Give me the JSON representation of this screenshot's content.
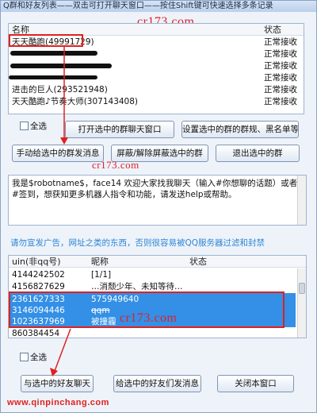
{
  "window": {
    "title": "Q群和好友列表——双击可打开聊天窗口——按住Shift键可快速选择多条记录"
  },
  "watermarks": {
    "top": "cr173.com",
    "mid": "cr173.com",
    "table": "cr173.com",
    "footer": "www.qinpinchang.com"
  },
  "groups": {
    "header_name": "名称",
    "header_status": "状态",
    "rows": [
      {
        "name": "天天酷跑(49991729)",
        "status": "正常接收"
      },
      {
        "name": "",
        "status": "正常接收"
      },
      {
        "name": "",
        "status": "正常接收"
      },
      {
        "name": "",
        "status": "正常接收"
      },
      {
        "name": "进击的巨人(293521948)",
        "status": "正常接收"
      },
      {
        "name": "天天酷跑♪节奏大师(307143408)",
        "status": "正常接收"
      }
    ],
    "select_all": "全选",
    "btn_open": "打开选中的群聊天窗口",
    "btn_rules": "设置选中的群的群规、黑名单等",
    "btn_send": "手动给选中的群发消息",
    "btn_block": "屏蔽/解除屏蔽选中的群",
    "btn_quit": "退出选中的群"
  },
  "message": {
    "text": "我是$robotname$，face14 欢迎大家找我聊天（输入#你想聊的话题）或者#签到，想获知更多机器人指令和功能，请发送help或帮助。"
  },
  "notice": "请勿宣发广告，网址之类的东西，否则很容易被QQ服务器过滤和封禁",
  "friends": {
    "header_uin": "uin(非qq号)",
    "header_nick": "昵称",
    "header_status": "状态",
    "rows": [
      {
        "uin": "4144242502",
        "nick": "[1/1]"
      },
      {
        "uin": "4156827629",
        "nick": "…消颓少年、未知等待…"
      },
      {
        "uin": "2361627333",
        "nick": "575949640"
      },
      {
        "uin": "3146094446",
        "nick": "qqm"
      },
      {
        "uin": "1023637969",
        "nick": "被撞霾"
      },
      {
        "uin": "860384454",
        "nick": ""
      },
      {
        "uin": "",
        "nick": ""
      }
    ],
    "select_all": "全选",
    "btn_chat": "与选中的好友聊天",
    "btn_send": "给选中的好友们发消息",
    "btn_close": "关闭本窗口"
  },
  "colors": {
    "highlight_box": "#e02020",
    "selected_row": "#3390e6",
    "notice_text": "#2e86d4"
  }
}
